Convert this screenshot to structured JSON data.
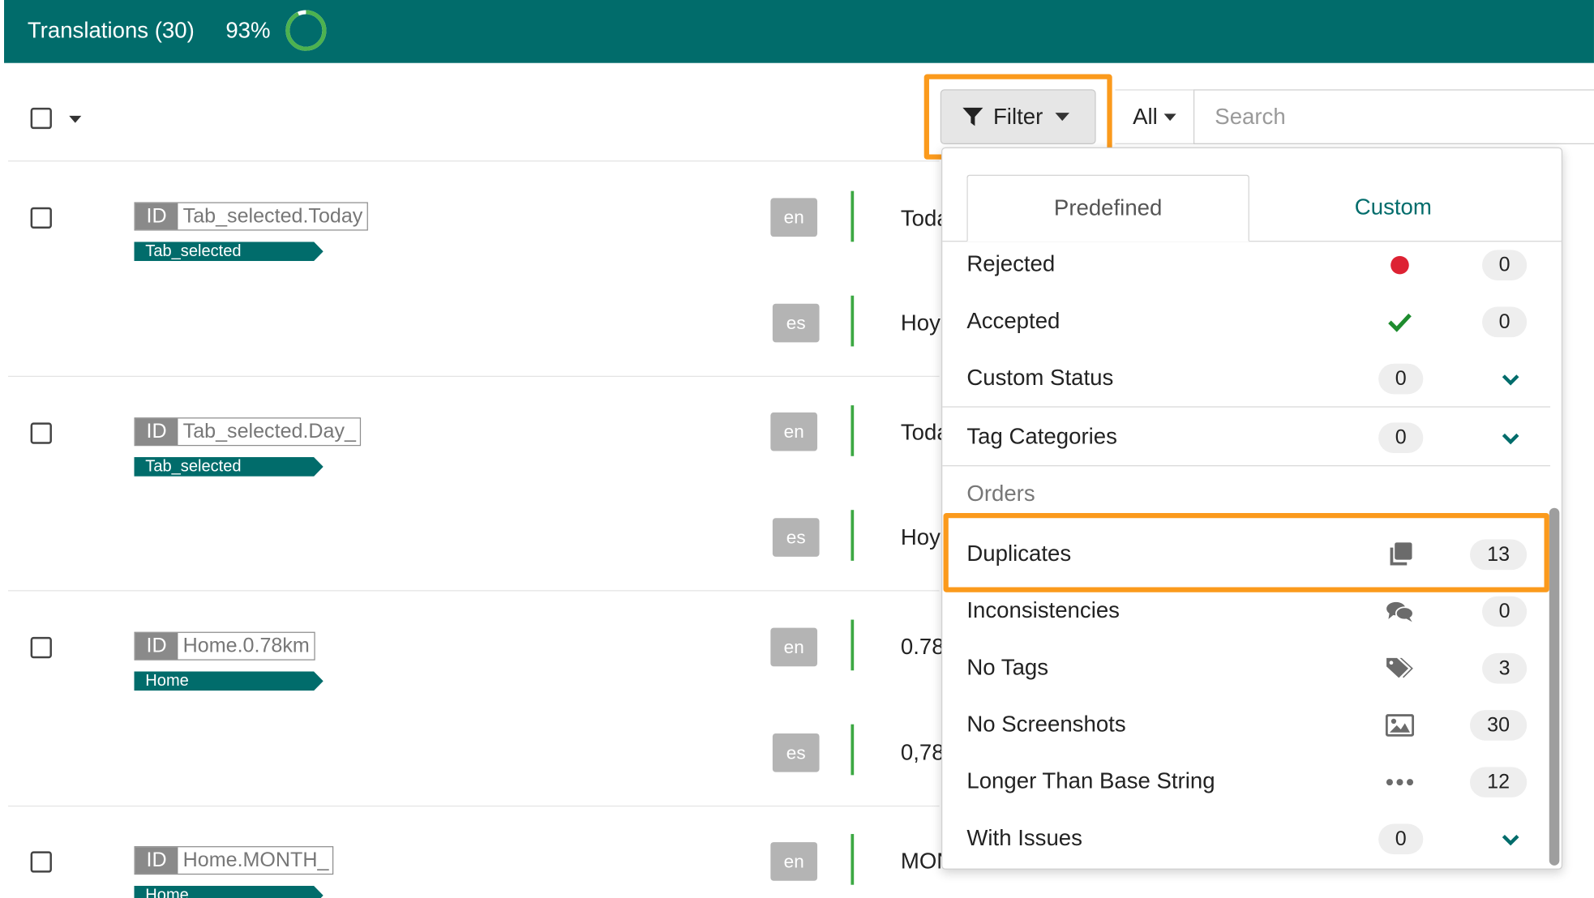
{
  "header": {
    "title": "Translations (30)",
    "percent": "93%",
    "progress": 0.93,
    "accent": "#016c6b"
  },
  "toolbar": {
    "filter_label": "Filter",
    "all_label": "All",
    "search_placeholder": "Search"
  },
  "rows": [
    {
      "id": "Tab_selected.Today",
      "tag": "Tab_selected",
      "translations": [
        {
          "lang": "en",
          "text": "Toda"
        },
        {
          "lang": "es",
          "text": "Hoy"
        }
      ]
    },
    {
      "id": "Tab_selected.Day_",
      "tag": "Tab_selected",
      "translations": [
        {
          "lang": "en",
          "text": "Toda"
        },
        {
          "lang": "es",
          "text": "Hoy"
        }
      ]
    },
    {
      "id": "Home.0.78km",
      "tag": "Home",
      "translations": [
        {
          "lang": "en",
          "text": "0.78"
        },
        {
          "lang": "es",
          "text": "0,78"
        }
      ]
    },
    {
      "id": "Home.MONTH_",
      "tag": "Home",
      "translations": [
        {
          "lang": "en",
          "text": "MON"
        }
      ]
    }
  ],
  "filter_menu": {
    "tabs": {
      "predefined": "Predefined",
      "custom": "Custom"
    },
    "status_items": [
      {
        "label": "Rejected",
        "count": "0",
        "icon": "red-dot-icon"
      },
      {
        "label": "Accepted",
        "count": "0",
        "icon": "check-icon"
      },
      {
        "label": "Custom Status",
        "count": "0",
        "icon": "chevron-down-icon"
      }
    ],
    "tag_categories": {
      "label": "Tag Categories",
      "count": "0"
    },
    "orders_title": "Orders",
    "order_items": [
      {
        "label": "Duplicates",
        "count": "13",
        "icon": "copy-icon"
      },
      {
        "label": "Inconsistencies",
        "count": "0",
        "icon": "comments-icon"
      },
      {
        "label": "No Tags",
        "count": "3",
        "icon": "tags-icon"
      },
      {
        "label": "No Screenshots",
        "count": "30",
        "icon": "image-icon"
      },
      {
        "label": "Longer Than Base String",
        "count": "12",
        "icon": "ellipsis-icon"
      },
      {
        "label": "With Issues",
        "count": "0",
        "icon": "chevron-down-icon"
      }
    ],
    "colors": {
      "rejected": "#dd2233",
      "accepted": "#1e8c2e",
      "highlight": "#fb9a1c"
    }
  }
}
